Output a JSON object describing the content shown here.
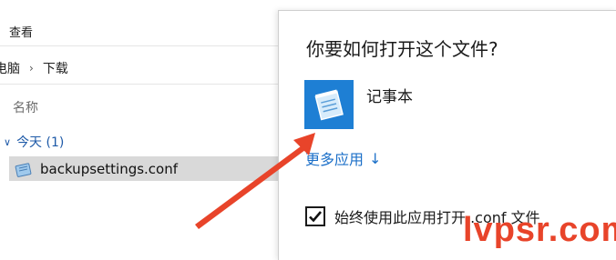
{
  "explorer": {
    "ribbon_tab": "查看",
    "breadcrumb": {
      "parent": "电脑",
      "separator": "›",
      "current": "下载"
    },
    "column_header": "名称",
    "group": {
      "label": "今天 (1)"
    },
    "file": {
      "name": "backupsettings.conf"
    }
  },
  "dialog": {
    "title": "你要如何打开这个文件?",
    "app": {
      "name": "记事本",
      "icon": "notepad-icon"
    },
    "more_apps": "更多应用",
    "more_apps_arrow": "↓",
    "always_use": {
      "label": "始终使用此应用打开 .conf 文件",
      "checked": true
    }
  },
  "watermark": "lvpsr.com",
  "colors": {
    "accent": "#1b6fc8",
    "app_tile": "#1e7fd4",
    "selection": "#d9d9d9",
    "arrow": "#e8442a"
  }
}
